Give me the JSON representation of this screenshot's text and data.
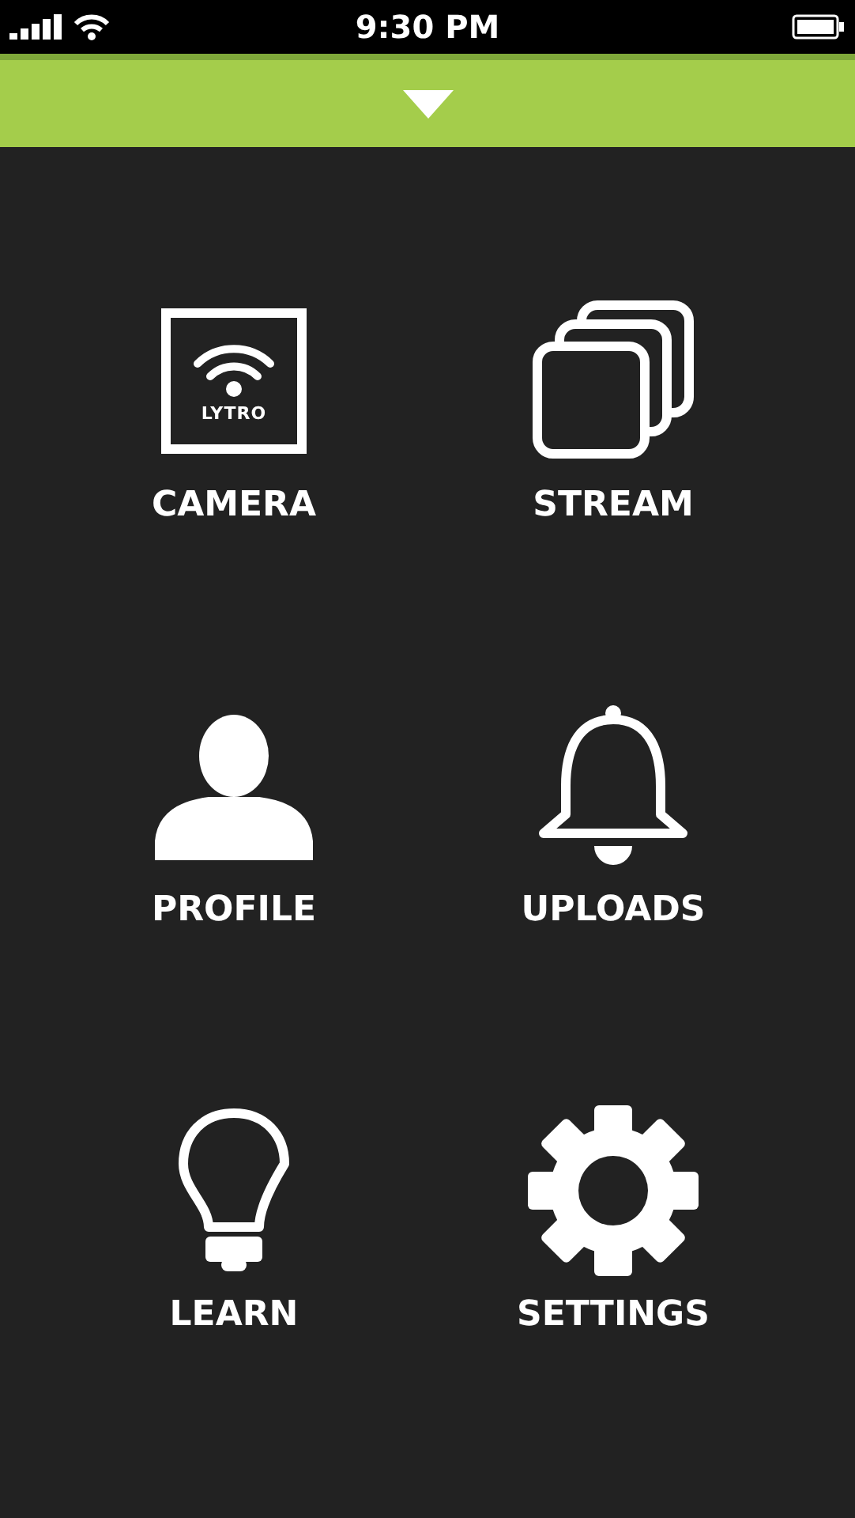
{
  "status_bar": {
    "time": "9:30 PM"
  },
  "menu": [
    {
      "kind": "camera",
      "label": "CAMERA",
      "logo_text": "LYTRO"
    },
    {
      "kind": "stream",
      "label": "STREAM"
    },
    {
      "kind": "profile",
      "label": "PROFILE"
    },
    {
      "kind": "uploads",
      "label": "UPLOADS"
    },
    {
      "kind": "learn",
      "label": "LEARN"
    },
    {
      "kind": "settings",
      "label": "SETTINGS"
    }
  ]
}
